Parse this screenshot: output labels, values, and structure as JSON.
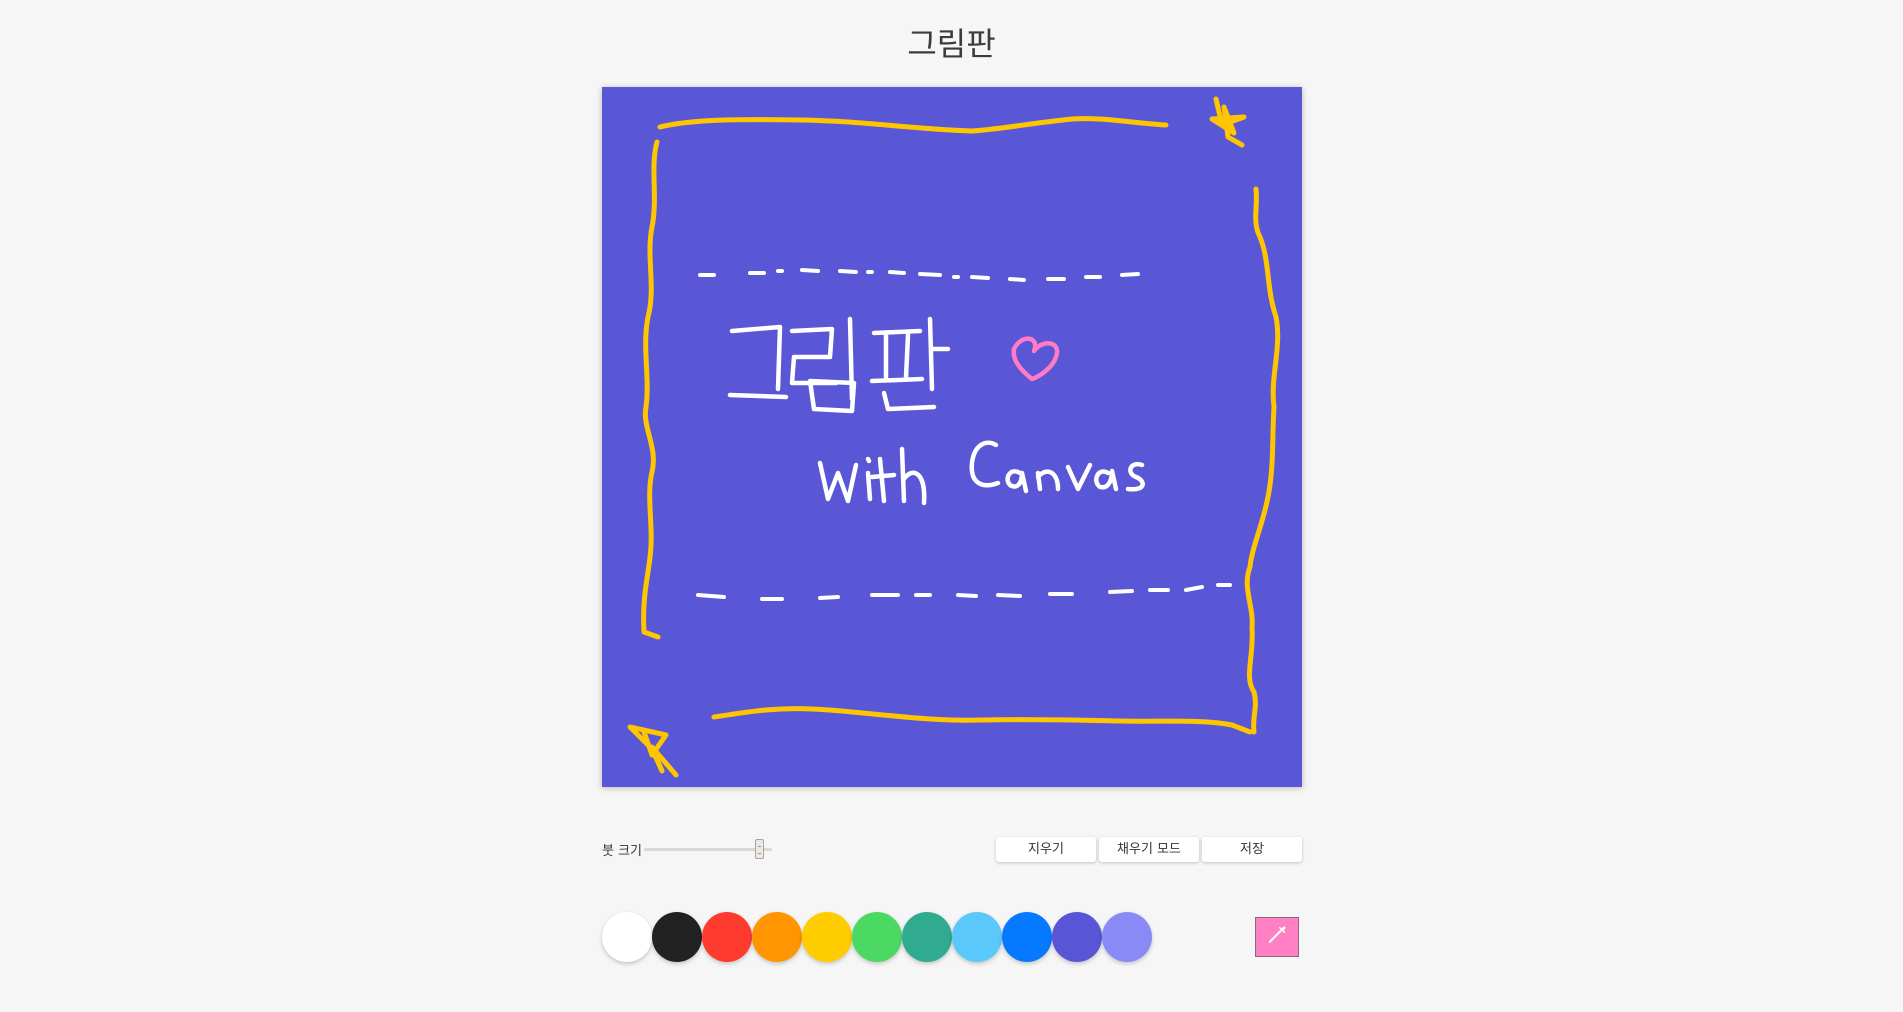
{
  "page": {
    "title": "그림판",
    "background": "#f6f6f6"
  },
  "canvas": {
    "fill_color": "#5957d6",
    "stroke_colors": {
      "border": "#ffc600",
      "text": "#ffffff",
      "heart": "#ff7bc5"
    }
  },
  "controls": {
    "brush_size_label": "붓 크기",
    "brush_size_value": 0.9,
    "buttons": [
      {
        "label": "지우기"
      },
      {
        "label": "채우기 모드"
      },
      {
        "label": "저장"
      }
    ]
  },
  "palette": [
    "#ffffff",
    "#222222",
    "#ff3b30",
    "#ff9500",
    "#ffcc00",
    "#4cd963",
    "#30ab8f",
    "#5ac8fa",
    "#0579ff",
    "#5856d6",
    "#8a8af7"
  ],
  "color_picker": {
    "value": "#ff80c4",
    "icon": "eyedropper-icon"
  }
}
